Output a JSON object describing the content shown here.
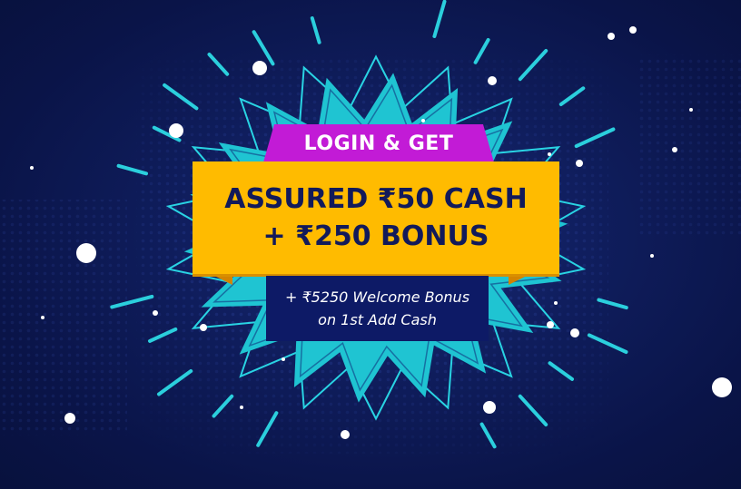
{
  "promo": {
    "headline_top": "LOGIN & GET",
    "main_line_1": "ASSURED ₹50 CASH",
    "main_line_2": "+ ₹250 BONUS",
    "sub_line_1": "+ ₹5250 Welcome Bonus",
    "sub_line_2": "on 1st Add Cash"
  },
  "colors": {
    "background": "#0b1650",
    "burst_fill": "#1fc4d2",
    "burst_outline": "#29d3e3",
    "ribbon": "#c21bd6",
    "main_box": "#ffbb00",
    "main_text": "#121a5a",
    "sub_box": "#0d1a66",
    "sub_text": "#ffffff"
  },
  "decorations": {
    "burst": "starburst-shape",
    "rays": "ray-lines",
    "dots": "sparkle-dots",
    "halftone": "halftone-pattern"
  }
}
